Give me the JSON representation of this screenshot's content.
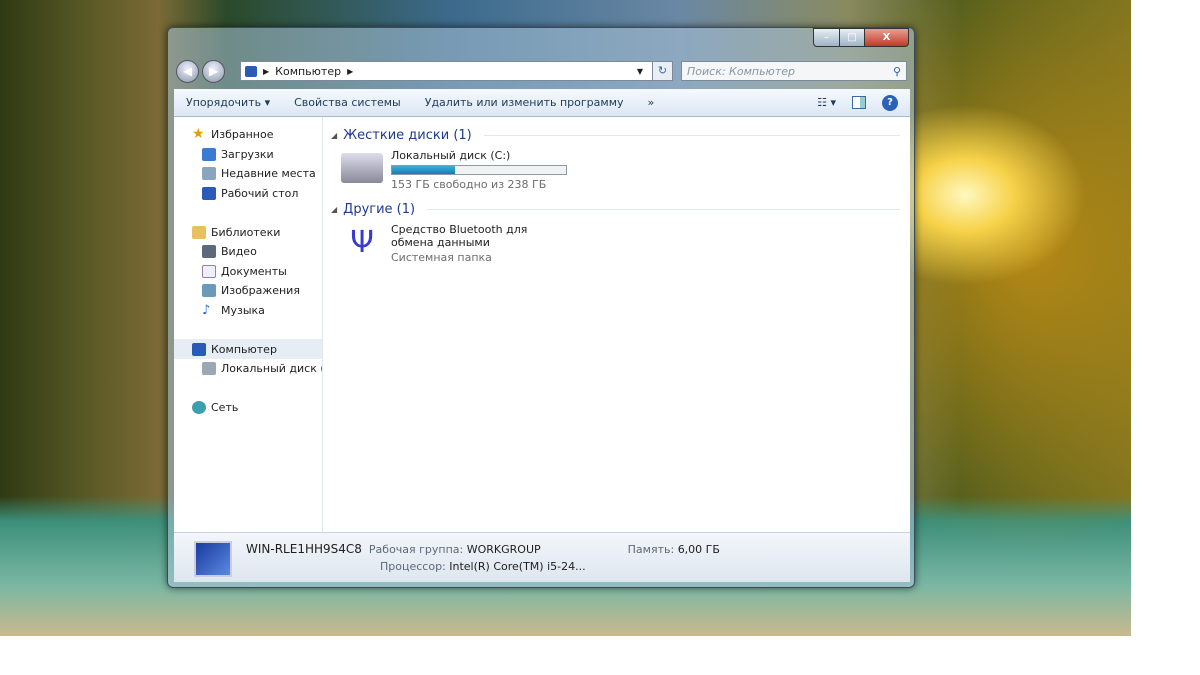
{
  "window": {
    "minimize": "–",
    "maximize": "□",
    "close": "X"
  },
  "address": {
    "crumb": "Компьютер",
    "search_placeholder": "Поиск: Компьютер"
  },
  "toolbar": {
    "organize": "Упорядочить ▾",
    "system_properties": "Свойства системы",
    "uninstall": "Удалить или изменить программу",
    "more": "»",
    "views": "▾"
  },
  "sidebar": {
    "favorites": "Избранное",
    "downloads": "Загрузки",
    "recent": "Недавние места",
    "desktop": "Рабочий стол",
    "libraries": "Библиотеки",
    "video": "Видео",
    "documents": "Документы",
    "pictures": "Изображения",
    "music": "Музыка",
    "computer": "Компьютер",
    "local_disk": "Локальный диск (C",
    "network": "Сеть"
  },
  "content": {
    "hdd_group": "Жесткие диски (1)",
    "disk_name": "Локальный диск (C:)",
    "disk_free": "153 ГБ свободно из 238 ГБ",
    "disk_used_percent": 36,
    "other_group": "Другие (1)",
    "bt_name": "Средство Bluetooth для обмена данными",
    "bt_type": "Системная папка"
  },
  "details": {
    "computer_name": "WIN-RLE1HH9S4C8",
    "workgroup_label": "Рабочая группа:",
    "workgroup": "WORKGROUP",
    "memory_label": "Память:",
    "memory": "6,00 ГБ",
    "cpu_label": "Процессор:",
    "cpu": "Intel(R) Core(TM) i5-24..."
  }
}
